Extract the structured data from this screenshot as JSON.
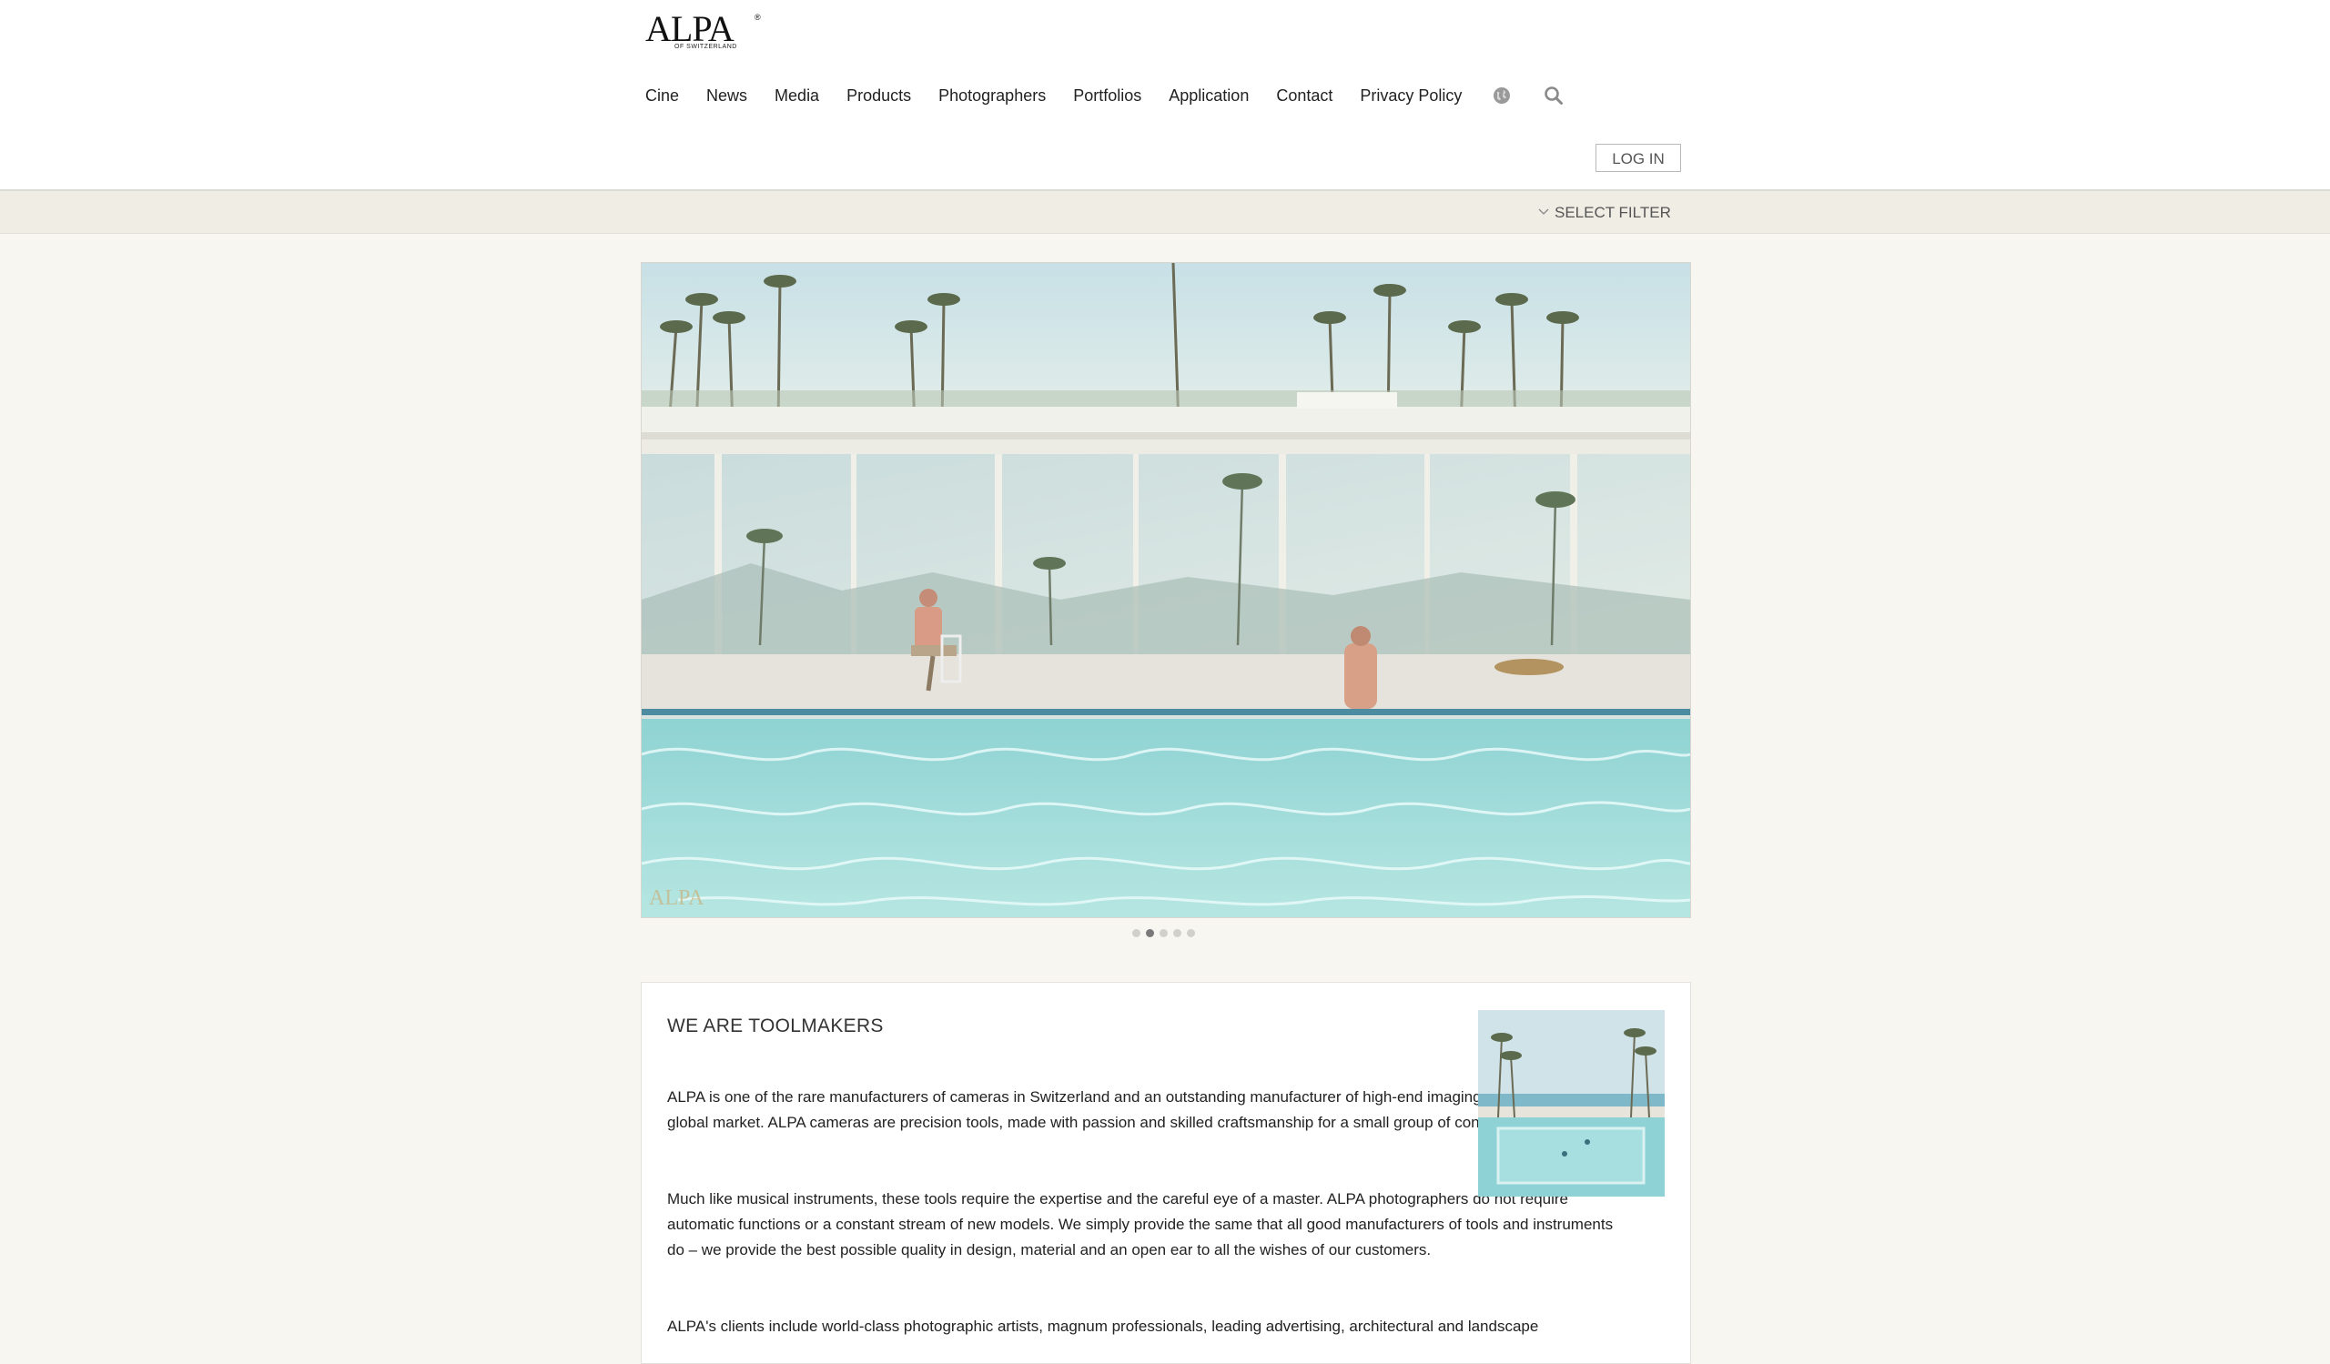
{
  "brand": {
    "logo_text": "ALPA",
    "logo_subtext": "OF SWITZERLAND",
    "logo_mark": "®"
  },
  "nav": {
    "items": [
      "Cine",
      "News",
      "Media",
      "Products",
      "Photographers",
      "Portfolios",
      "Application",
      "Contact",
      "Privacy Policy"
    ],
    "language_icon": "globe-icon",
    "search_icon": "search-icon"
  },
  "account": {
    "login_label": "LOG IN"
  },
  "filter": {
    "label": "SELECT FILTER",
    "icon": "chevron-down-icon"
  },
  "hero": {
    "watermark": "ALPA",
    "slide_count": 5,
    "active_slide": 2
  },
  "article": {
    "title": "WE ARE TOOLMAKERS",
    "paragraphs": [
      "ALPA is one of the rare manufacturers of cameras in Switzerland and an outstanding manufacturer of high-end imaging instruments in the global market. ALPA cameras are precision tools, made with passion and skilled craftsmanship for a small group of connoisseurs.",
      "Much like musical instruments, these tools require the expertise and the careful eye of a master. ALPA photographers do not require automatic functions or a constant stream of new models. We simply provide the same that all good manufacturers of tools and instruments do – we provide the best possible quality in design, material and an open ear to all the wishes of our customers.",
      "ALPA's clients include world-class photographic artists, magnum professionals, leading advertising, architectural and landscape"
    ]
  },
  "colors": {
    "page_bg": "#f8f6f1",
    "filter_bar": "#f0ede4",
    "pool_water": "#9fdad8",
    "sky": "#cfe5ea"
  }
}
